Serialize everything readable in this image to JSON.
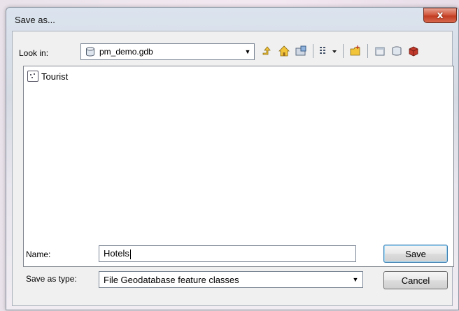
{
  "dialog": {
    "title": "Save as...",
    "close_label": "x"
  },
  "lookin": {
    "label": "Look in:",
    "value": "pm_demo.gdb"
  },
  "toolbar": {
    "icons": [
      "up-one-level-icon",
      "home-icon",
      "connect-folder-icon",
      "view-menu-icon",
      "new-folder-icon",
      "new-feature-dataset-icon",
      "new-file-geodatabase-icon",
      "new-personal-geodatabase-icon"
    ]
  },
  "files": [
    {
      "name": "Tourist",
      "icon": "feature-dataset-icon"
    }
  ],
  "form": {
    "name_label": "Name:",
    "name_value": "Hotels",
    "type_label": "Save as type:",
    "type_value": "File Geodatabase feature classes"
  },
  "buttons": {
    "save_label": "Save",
    "cancel_label": "Cancel"
  }
}
